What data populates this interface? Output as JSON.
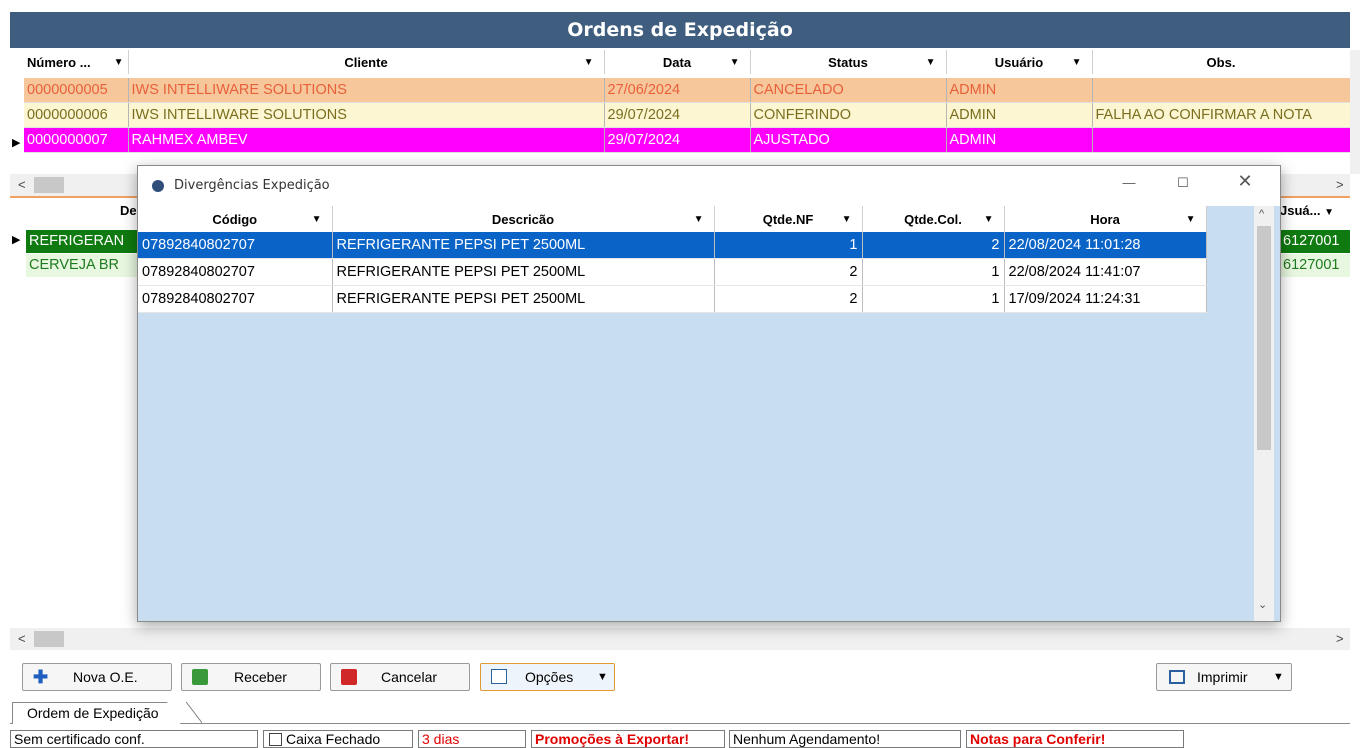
{
  "main": {
    "title": "Ordens de Expedição",
    "columns": [
      "Número ...",
      "Cliente",
      "Data",
      "Status",
      "Usuário",
      "Obs."
    ],
    "rows": [
      {
        "numero": "0000000005",
        "cliente": "IWS INTELLIWARE SOLUTIONS",
        "data": "27/06/2024",
        "status": "CANCELADO",
        "usuario": "ADMIN",
        "obs": "",
        "bg": "#f6c79b",
        "fg": "#e8603a"
      },
      {
        "numero": "0000000006",
        "cliente": "IWS INTELLIWARE SOLUTIONS",
        "data": "29/07/2024",
        "status": "CONFERINDO",
        "usuario": "ADMIN",
        "obs": "FALHA AO CONFIRMAR A NOTA",
        "bg": "#fcf6d2",
        "fg": "#7a6e1e"
      },
      {
        "numero": "0000000007",
        "cliente": "RAHMEX AMBEV",
        "data": "29/07/2024",
        "status": "AJUSTADO",
        "usuario": "ADMIN",
        "obs": "",
        "bg": "#ff00ff",
        "fg": "#ffffff"
      }
    ]
  },
  "detail": {
    "column_partial": "De",
    "column_usuario": "Jsuá...",
    "rows": [
      {
        "desc": "REFRIGERAN",
        "user": "6127001",
        "bg": "#0f7a0f",
        "fg": "#ffffff"
      },
      {
        "desc": "CERVEJA BR",
        "user": "6127001",
        "bg": "#e8f8e0",
        "fg": "#1e7a1e"
      }
    ]
  },
  "dialog": {
    "title": "Divergências Expedição",
    "columns": [
      "Código",
      "Descricão",
      "Qtde.NF",
      "Qtde.Col.",
      "Hora"
    ],
    "rows": [
      {
        "codigo": "07892840802707",
        "descricao": "REFRIGERANTE PEPSI PET 2500ML",
        "qtde_nf": "1",
        "qtde_col": "2",
        "hora": "22/08/2024 11:01:28",
        "selected": true
      },
      {
        "codigo": "07892840802707",
        "descricao": "REFRIGERANTE PEPSI PET 2500ML",
        "qtde_nf": "2",
        "qtde_col": "1",
        "hora": "22/08/2024 11:41:07",
        "selected": false
      },
      {
        "codigo": "07892840802707",
        "descricao": "REFRIGERANTE PEPSI PET 2500ML",
        "qtde_nf": "2",
        "qtde_col": "1",
        "hora": "17/09/2024 11:24:31",
        "selected": false
      }
    ]
  },
  "toolbar": {
    "nova": "Nova O.E.",
    "receber": "Receber",
    "cancelar": "Cancelar",
    "opcoes": "Opções",
    "imprimir": "Imprimir"
  },
  "tab": "Ordem de Expedição",
  "status": {
    "certificado": "Sem certificado conf.",
    "caixa": "Caixa Fechado",
    "dias": "3 dias",
    "promocoes": "Promoções à Exportar!",
    "agendamento": "Nenhum Agendamento!",
    "notas": "Notas para Conferir!"
  },
  "colors": {
    "header_bg": "#3f5d7f",
    "selection": "#0a64c8",
    "dialog_bg": "#c9ddf0",
    "alert_red": "#e00000"
  }
}
